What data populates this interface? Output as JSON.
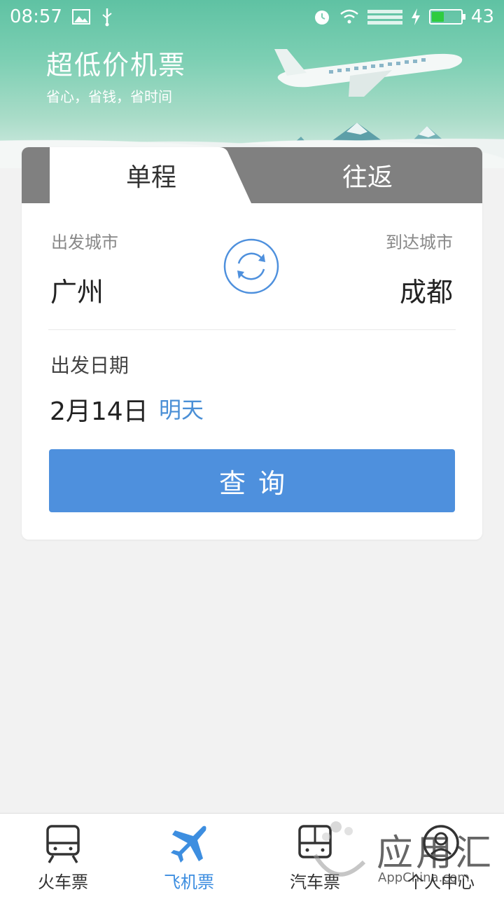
{
  "status_bar": {
    "time": "08:57",
    "battery": "43",
    "battery_level": 0.43
  },
  "hero": {
    "title": "超低价机票",
    "subtitle": "省心，省钱，省时间"
  },
  "tabs": [
    {
      "label": "单程",
      "active": true
    },
    {
      "label": "往返",
      "active": false
    }
  ],
  "trip": {
    "from_label": "出发城市",
    "from_city": "广州",
    "to_label": "到达城市",
    "to_city": "成都",
    "date_label": "出发日期",
    "date_value": "2月14日",
    "date_relative": "明天"
  },
  "search_button": "查询",
  "bottom_nav": [
    {
      "label": "火车票",
      "icon": "train-icon",
      "active": false
    },
    {
      "label": "飞机票",
      "icon": "airplane-icon",
      "active": true
    },
    {
      "label": "汽车票",
      "icon": "bus-icon",
      "active": false
    },
    {
      "label": "个人中心",
      "icon": "profile-icon",
      "active": false
    }
  ],
  "watermark": {
    "text": "应用汇",
    "sub": "AppChina.com"
  },
  "colors": {
    "accent": "#4e90dd",
    "active_nav": "#3d8ee0",
    "tab_inactive": "#808080"
  }
}
